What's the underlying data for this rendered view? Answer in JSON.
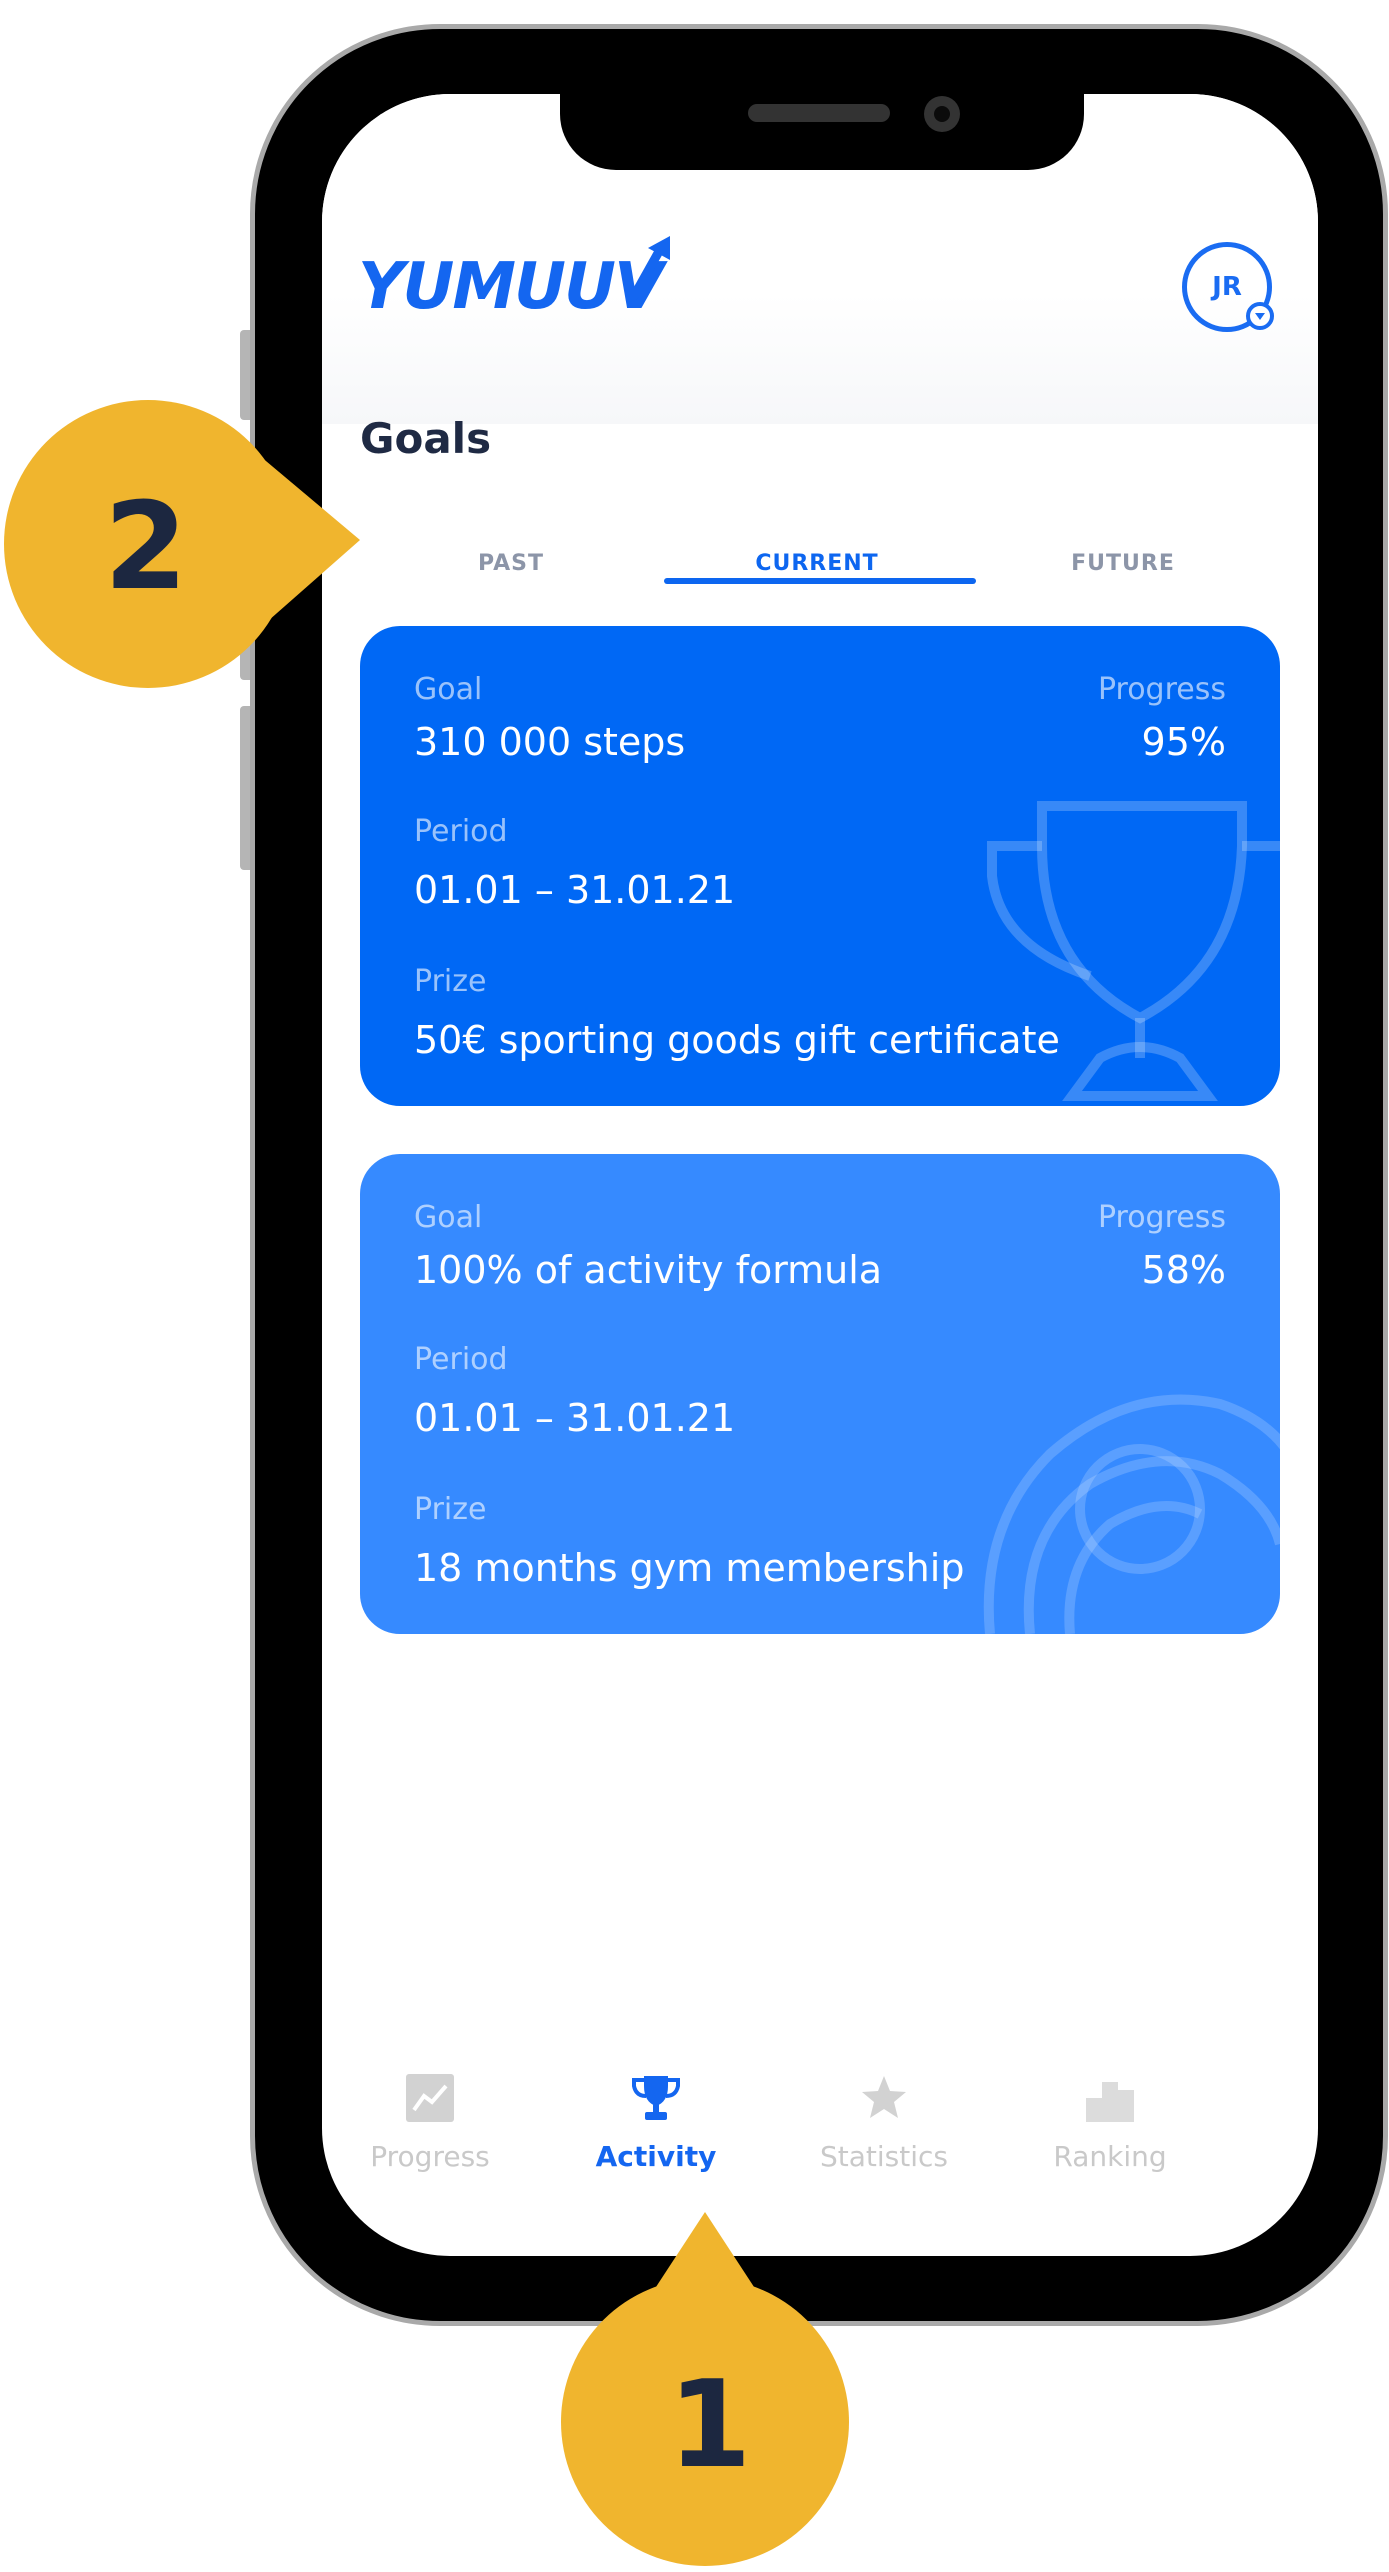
{
  "header": {
    "logo_text": "YUMUUV",
    "avatar_initials": "JR"
  },
  "page": {
    "title": "Goals",
    "tabs": [
      {
        "label": "PAST",
        "active": false
      },
      {
        "label": "CURRENT",
        "active": true
      },
      {
        "label": "FUTURE",
        "active": false
      }
    ]
  },
  "goals": [
    {
      "goal_label": "Goal",
      "goal_value": "310 000 steps",
      "progress_label": "Progress",
      "progress_value": "95%",
      "period_label": "Period",
      "period_value": "01.01 – 31.01.21",
      "prize_label": "Prize",
      "prize_value": "50€ sporting goods gift certificate",
      "icon": "trophy-icon",
      "color": "#0068f5"
    },
    {
      "goal_label": "Goal",
      "goal_value": "100% of activity formula",
      "progress_label": "Progress",
      "progress_value": "58%",
      "period_label": "Period",
      "period_value": "01.01 – 31.01.21",
      "prize_label": "Prize",
      "prize_value": "18 months gym membership",
      "icon": "activity-rings-icon",
      "color": "#368aff"
    }
  ],
  "tabbar": {
    "items": [
      {
        "label": "Progress",
        "icon": "chart-icon",
        "active": false
      },
      {
        "label": "Activity",
        "icon": "trophy-icon",
        "active": true
      },
      {
        "label": "Statistics",
        "icon": "star-icon",
        "active": false
      },
      {
        "label": "Ranking",
        "icon": "podium-icon",
        "active": false
      }
    ]
  },
  "callouts": [
    {
      "number": "2"
    },
    {
      "number": "1"
    }
  ],
  "colors": {
    "accent": "#0d66f0",
    "callout": "#f0b52e",
    "inactive": "#c9c9c9"
  }
}
